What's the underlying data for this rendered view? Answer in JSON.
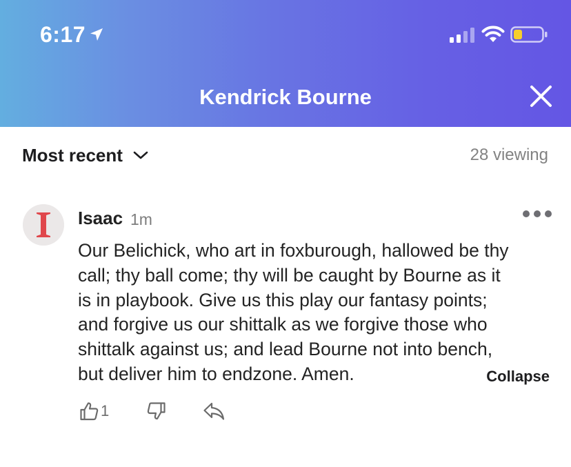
{
  "status_bar": {
    "time": "6:17",
    "icons": [
      "location-arrow-icon",
      "cellular-signal-icon",
      "wifi-icon",
      "battery-low-icon"
    ],
    "battery_color": "#f6cf2c"
  },
  "header": {
    "title": "Kendrick Bourne",
    "close_icon": "close-icon",
    "gradient_start": "#63aee0",
    "gradient_end": "#6456e4"
  },
  "sort": {
    "label": "Most recent",
    "icon": "chevron-down-icon"
  },
  "viewers": {
    "label": "28 viewing"
  },
  "comment": {
    "author": "Isaac",
    "time": "1m",
    "avatar_letter": "I",
    "avatar_letter_color": "#e0474c",
    "more_icon": "more-horizontal-icon",
    "body_lines": [
      "Our Belichick, who art in foxburough, hallowed be thy",
      "call; thy ball come; thy will be caught by Bourne as it",
      "is in playbook. Give us this play our fantasy points;",
      "and forgive us our shittalk as we forgive those who",
      "shittalk against us; and lead Bourne not into bench,",
      "but deliver him to endzone. Amen."
    ],
    "collapse_label": "Collapse",
    "likes": "1",
    "actions": [
      "thumbs-up-icon",
      "thumbs-down-icon",
      "reply-icon"
    ]
  }
}
